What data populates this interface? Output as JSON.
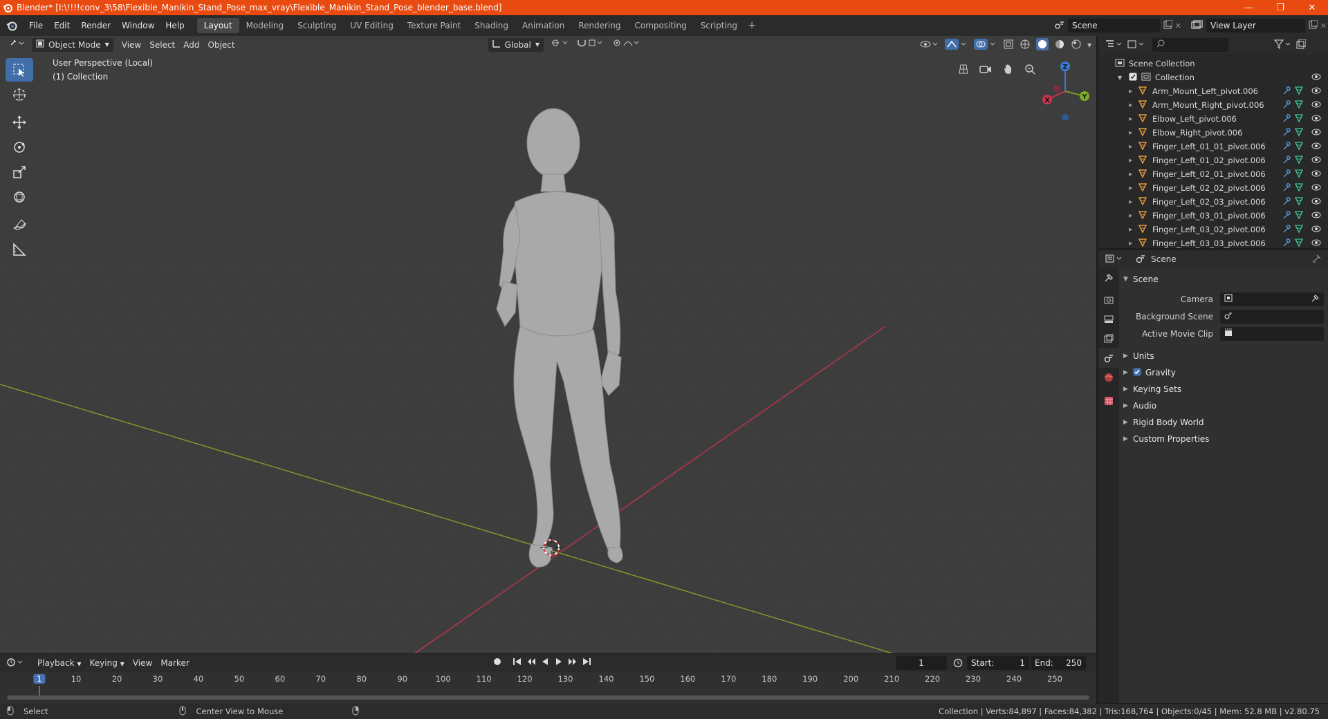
{
  "titlebar": {
    "title": "Blender* [I:\\!!!!conv_3\\58\\Flexible_Manikin_Stand_Pose_max_vray\\Flexible_Manikin_Stand_Pose_blender_base.blend]",
    "minimize": "—",
    "maximize": "❐",
    "close": "✕"
  },
  "menu": [
    "File",
    "Edit",
    "Render",
    "Window",
    "Help"
  ],
  "workspaces": [
    "Layout",
    "Modeling",
    "Sculpting",
    "UV Editing",
    "Texture Paint",
    "Shading",
    "Animation",
    "Rendering",
    "Compositing",
    "Scripting"
  ],
  "workspace_add": "+",
  "scene_name": "Scene",
  "view_layer_name": "View Layer",
  "viewport": {
    "mode": "Object Mode",
    "header_menus": [
      "View",
      "Select",
      "Add",
      "Object"
    ],
    "transform_orientation": "Global",
    "perspective_label": "User Perspective (Local)",
    "collection_label": "(1) Collection",
    "gizmo": {
      "z": "Z",
      "y": "Y",
      "x": "X"
    }
  },
  "outliner": {
    "root": "Scene Collection",
    "collection": "Collection",
    "items": [
      "Arm_Mount_Left_pivot.006",
      "Arm_Mount_Right_pivot.006",
      "Elbow_Left_pivot.006",
      "Elbow_Right_pivot.006",
      "Finger_Left_01_01_pivot.006",
      "Finger_Left_01_02_pivot.006",
      "Finger_Left_02_01_pivot.006",
      "Finger_Left_02_02_pivot.006",
      "Finger_Left_02_03_pivot.006",
      "Finger_Left_03_01_pivot.006",
      "Finger_Left_03_02_pivot.006",
      "Finger_Left_03_03_pivot.006"
    ]
  },
  "properties": {
    "context": "Scene",
    "panel_title": "Scene",
    "camera_label": "Camera",
    "background_scene_label": "Background Scene",
    "active_movie_clip_label": "Active Movie Clip",
    "subpanels": [
      "Units",
      "Gravity",
      "Keying Sets",
      "Audio",
      "Rigid Body World",
      "Custom Properties"
    ]
  },
  "timeline": {
    "menus": [
      "Playback",
      "Keying",
      "View",
      "Marker"
    ],
    "current_frame": "1",
    "start_label": "Start:",
    "start": "1",
    "end_label": "End:",
    "end": "250",
    "ticks": [
      "1",
      "10",
      "20",
      "30",
      "40",
      "50",
      "60",
      "70",
      "80",
      "90",
      "100",
      "110",
      "120",
      "130",
      "140",
      "150",
      "160",
      "170",
      "180",
      "190",
      "200",
      "210",
      "220",
      "230",
      "240",
      "250"
    ]
  },
  "statusbar": {
    "select": "Select",
    "center_view": "Center View to Mouse",
    "stats": "Collection | Verts:84,897 | Faces:84,382 | Tris:168,764 | Objects:0/45 | Mem: 52.8 MB | v2.80.75"
  },
  "colors": {
    "titlebar": "#e84a10",
    "active_tool": "#3f6ea9",
    "x_axis": "#c8354a",
    "y_axis": "#7c9a2a",
    "z_axis": "#3a7ad0",
    "object_icon": "#e89a3c"
  }
}
